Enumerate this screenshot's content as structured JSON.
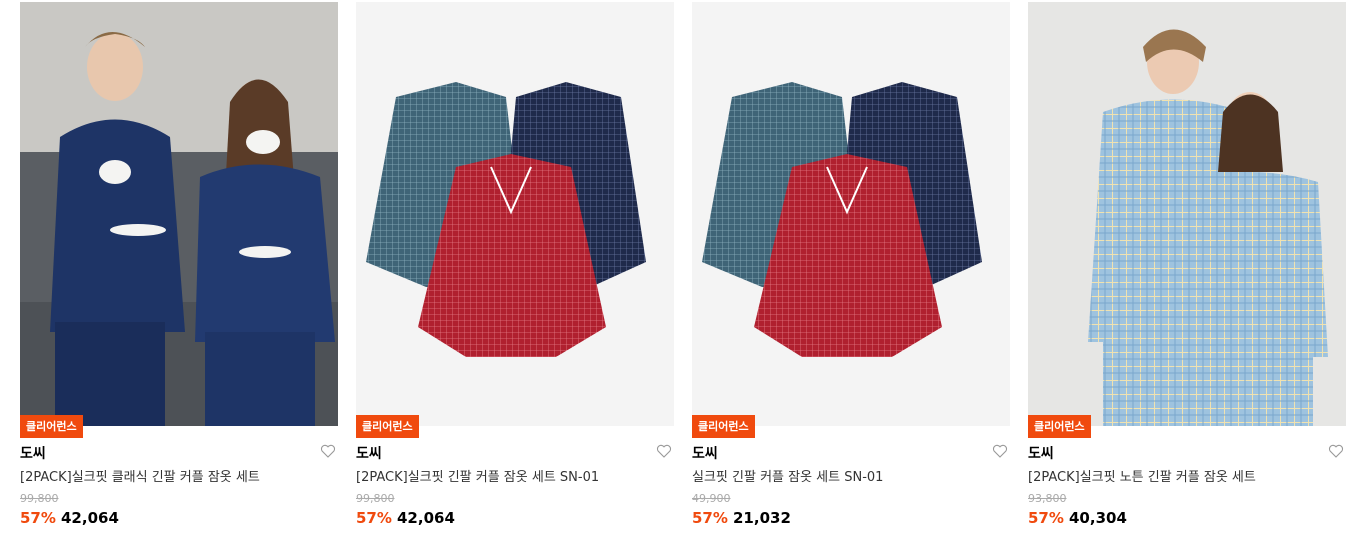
{
  "products": [
    {
      "badge": "클리어런스",
      "brand": "도씨",
      "title": "[2PACK]실크핏 클래식 긴팔 커플 잠옷 세트",
      "original_price": "99,800",
      "discount": "57%",
      "price": "42,064",
      "image": "couple-navy-pajamas-photo"
    },
    {
      "badge": "클리어런스",
      "brand": "도씨",
      "title": "[2PACK]실크핏 긴팔 커플 잠옷 세트 SN-01",
      "original_price": "99,800",
      "discount": "57%",
      "price": "42,064",
      "image": "three-check-shirts-photo"
    },
    {
      "badge": "클리어런스",
      "brand": "도씨",
      "title": "실크핏 긴팔 커플 잠옷 세트 SN-01",
      "original_price": "49,900",
      "discount": "57%",
      "price": "21,032",
      "image": "three-check-shirts-photo"
    },
    {
      "badge": "클리어런스",
      "brand": "도씨",
      "title": "[2PACK]실크핏 노튼 긴팔 커플 잠옷 세트",
      "original_price": "93,800",
      "discount": "57%",
      "price": "40,304",
      "image": "couple-blue-check-pajamas-photo"
    }
  ],
  "colors": {
    "accent": "#f04a0e",
    "strike_price": "#aaaaaa"
  }
}
